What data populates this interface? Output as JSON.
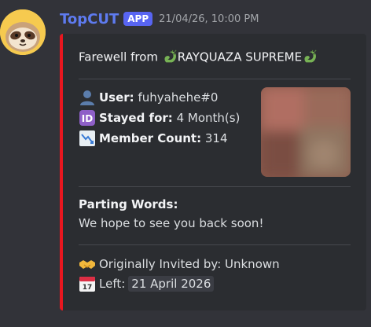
{
  "message": {
    "username": "TopCUT",
    "badge": "APP",
    "timestamp": "21/04/26, 10:00 PM"
  },
  "embed": {
    "accent_color": "#e8171f",
    "title_prefix": "Farewell from ",
    "title_server": "RAYQUAZA SUPREME",
    "fields": {
      "user_label": "User:",
      "user_value": "fuhyahehe#0",
      "stayed_label": "Stayed for:",
      "stayed_value": "4 Month(s)",
      "member_label": "Member Count:",
      "member_value": "314"
    },
    "parting": {
      "title": "Parting Words:",
      "text": "We hope to see you back soon!"
    },
    "footer": {
      "invited_text": "Originally Invited by: Unknown",
      "left_label": "Left:",
      "left_date": "21 April 2026"
    }
  },
  "icons": {
    "avatar": "sloth-avatar",
    "user": "bust-in-silhouette-icon",
    "stayed": "id-button-icon",
    "members": "chart-decreasing-icon",
    "dragon": "dragon-icon",
    "handshake": "handshake-icon",
    "calendar": "calendar-icon"
  }
}
